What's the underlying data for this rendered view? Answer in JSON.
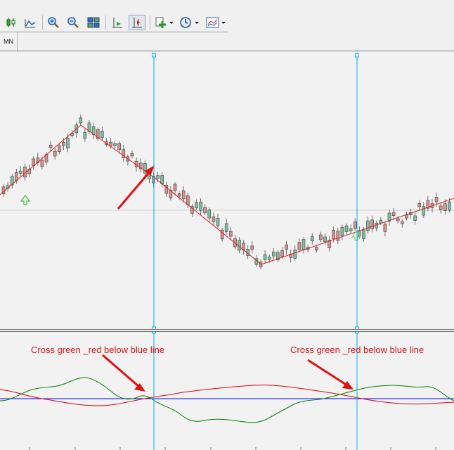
{
  "toolbar": {
    "buttons": [
      {
        "id": "candlestick",
        "icon": "candlestick-icon"
      },
      {
        "id": "line",
        "icon": "line-chart-icon"
      },
      {
        "id": "zoom-in",
        "icon": "zoom-in-icon"
      },
      {
        "id": "zoom-out",
        "icon": "zoom-out-icon"
      },
      {
        "id": "tile",
        "icon": "tile-windows-icon"
      },
      {
        "id": "autoscroll",
        "icon": "autoscroll-icon"
      },
      {
        "id": "chart-shift",
        "icon": "chart-shift-icon"
      },
      {
        "id": "indicators",
        "icon": "add-indicator-icon"
      },
      {
        "id": "periods",
        "icon": "clock-icon"
      },
      {
        "id": "templates",
        "icon": "template-icon"
      }
    ]
  },
  "timeframe_tab": {
    "label": "MN"
  },
  "annotations": {
    "left": "Cross green _red below blue line",
    "right": "Cross green _red below blue line"
  },
  "colors": {
    "vline": "#00b0e0",
    "zigzag": "#e02020",
    "osc_green": "#008000",
    "osc_red": "#e00000",
    "osc_baseline": "#0000ff",
    "bull": "#7fbfa0",
    "bear": "#d8908a",
    "arrow_up": "#40c040"
  }
}
